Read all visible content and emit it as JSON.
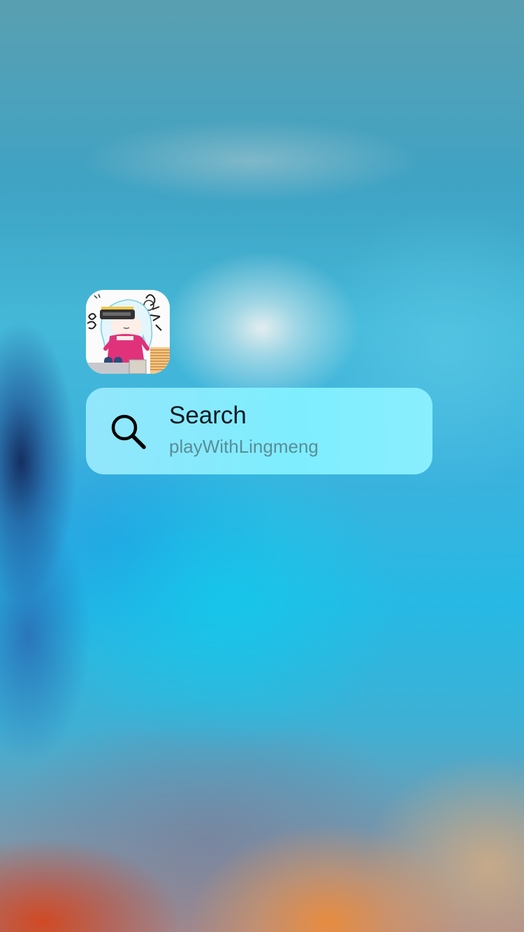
{
  "app": {
    "icon_name": "app-icon-anime-character"
  },
  "quick_action": {
    "icon_name": "search-icon",
    "title": "Search",
    "subtitle": "playWithLingmeng"
  },
  "colors": {
    "action_background": "#8ef0ff",
    "action_title": "#0b1a24",
    "action_subtitle": "#5a8c98"
  }
}
